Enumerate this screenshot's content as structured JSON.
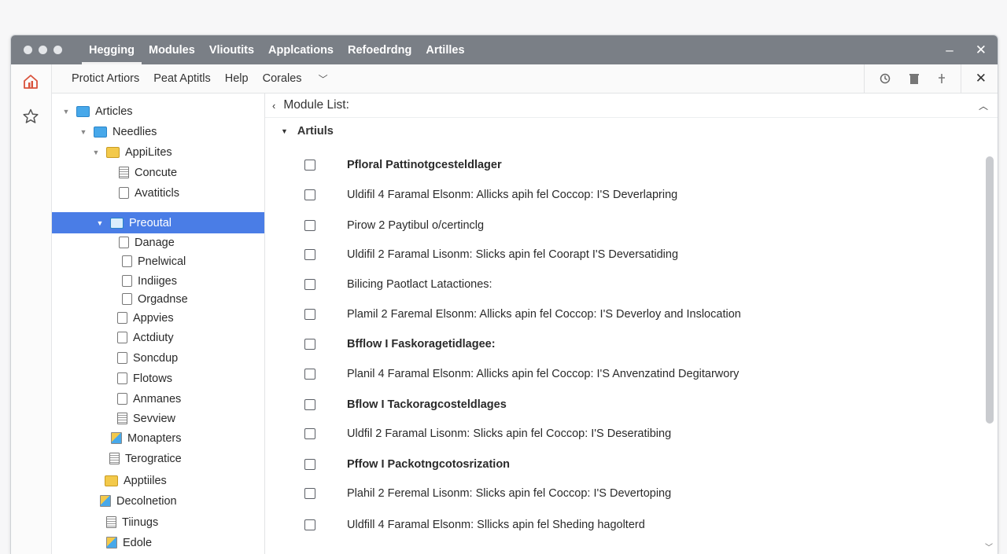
{
  "titlebar": {
    "tabs": [
      {
        "label": "Hegging",
        "active": true
      },
      {
        "label": "Modules",
        "active": false
      },
      {
        "label": "Vlioutits",
        "active": false
      },
      {
        "label": "Applcations",
        "active": false
      },
      {
        "label": "Refoedrdng",
        "active": false
      },
      {
        "label": "Artilles",
        "active": false
      }
    ],
    "minimize_icon": "–",
    "close_icon": "✕"
  },
  "leftrail": {
    "icons": [
      "home-icon",
      "star-icon"
    ],
    "home_color": "#d9523b"
  },
  "toolbar": {
    "menu": [
      "Protict Artiors",
      "Peat Aptitls",
      "Help",
      "Corales"
    ],
    "chevron": "﹀",
    "icons": [
      "refresh-icon",
      "trash-icon",
      "pin-icon"
    ],
    "close": "✕"
  },
  "sidebar": {
    "selected_color": "#4a7de6",
    "items": [
      {
        "label": "Articles",
        "icon": "folder-blue",
        "twisty": "▼"
      },
      {
        "label": "Needlies",
        "icon": "folder-blue",
        "twisty": "▼"
      },
      {
        "label": "AppiLites",
        "icon": "folder-yellow",
        "twisty": "▼"
      },
      {
        "label": "Concute",
        "icon": "page-lines",
        "twisty": ""
      },
      {
        "label": "Avatiticls",
        "icon": "page",
        "twisty": ""
      },
      {
        "label": "Preoutal",
        "icon": "folder-outline-blue",
        "twisty": "▼",
        "selected": true
      },
      {
        "label": "Danage",
        "icon": "page",
        "twisty": ""
      },
      {
        "label": "Pnelwical",
        "icon": "page",
        "twisty": ""
      },
      {
        "label": "Indiiges",
        "icon": "page",
        "twisty": ""
      },
      {
        "label": "Orgadnse",
        "icon": "page",
        "twisty": ""
      },
      {
        "label": "Appvies",
        "icon": "page",
        "twisty": ""
      },
      {
        "label": "Actdiuty",
        "icon": "page",
        "twisty": ""
      },
      {
        "label": "Soncdup",
        "icon": "page",
        "twisty": ""
      },
      {
        "label": "Flotows",
        "icon": "page",
        "twisty": ""
      },
      {
        "label": "Anmanes",
        "icon": "page",
        "twisty": ""
      },
      {
        "label": "Sevview",
        "icon": "page-lines",
        "twisty": ""
      },
      {
        "label": "Monapters",
        "icon": "mixed",
        "twisty": ""
      },
      {
        "label": "Terograticе",
        "icon": "page-lines",
        "twisty": ""
      },
      {
        "label": "Apptiiles",
        "icon": "folder-yellow",
        "twisty": ""
      },
      {
        "label": "Decolnetion",
        "icon": "mixed",
        "twisty": ""
      },
      {
        "label": "Tiinugs",
        "icon": "page-lines",
        "twisty": ""
      },
      {
        "label": "Edole",
        "icon": "mixed",
        "twisty": ""
      }
    ]
  },
  "main": {
    "header": "Module List:",
    "back_chevron": "‹",
    "collapse_chevron": "︿",
    "section": "Artiuls",
    "rows": [
      {
        "label": "Pfloral Pattinotgcesteldlager",
        "bold": true
      },
      {
        "label": "Uldifil 4 Faramal Elsonm: Allicks apih fel Coccop: I'S Deverlapring",
        "bold": false
      },
      {
        "label": "Pirow 2 Paytibul o/certinclg",
        "bold": false
      },
      {
        "label": "Uldifil 2 Faramal Lisonm: Slicks apin fel Coorapt I'S Deversatiding",
        "bold": false
      },
      {
        "label": "Bilicing Paotlact Latactiones:",
        "bold": false
      },
      {
        "label": "Plamil 2 Faremal Elsonm: Allicks apin fel Coccop: I'S Deverloy and Inslocation",
        "bold": false
      },
      {
        "label": "Bfflow I Faskoragetidlagee:",
        "bold": true
      },
      {
        "label": "Planil 4 Faramal Elsonm: Allicks apin fel Coccop: I'S Anvenzatind Degitarwory",
        "bold": false
      },
      {
        "label": "Bflow I Tackoragcosteldlages",
        "bold": true
      },
      {
        "label": "Uldfil 2 Faramal Lisonm: Slicks apin fel Coccop: I'S Deseratibing",
        "bold": false
      },
      {
        "label": "Pffow I Packotngcotosrization",
        "bold": true
      },
      {
        "label": "Plahil 2 Feremal Lisonm: Slicks apin fel Coccop: I'S Devertoping",
        "bold": false
      },
      {
        "label": "Uldfill 4 Faramal Elsonm: Sllicks apin fel Sheding hagolterd",
        "bold": false
      }
    ],
    "scroll_down": "﹀"
  }
}
